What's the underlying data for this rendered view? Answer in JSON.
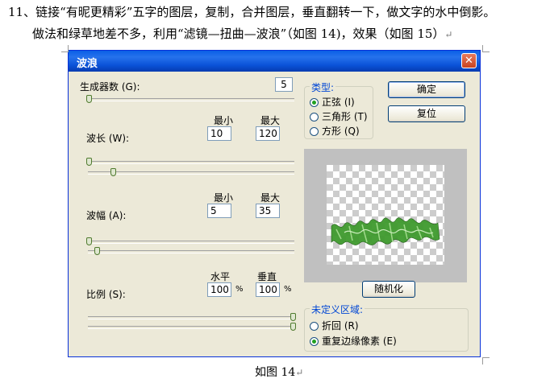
{
  "document": {
    "line1": "11、链接“有昵更精彩”五字的图层，复制，合并图层，垂直翻转一下，做文字的水中倒影。",
    "line2": "做法和绿草地差不多，利用“滤镜—扭曲—波浪”（如图 14)，效果（如图 15）",
    "caption": "如图 14",
    "para_mark": "↵"
  },
  "dialog": {
    "title": "波浪",
    "generators_label": "生成器数 (G):",
    "generators_value": "5",
    "wavelength": {
      "label": "波长 (W):",
      "min_header": "最小",
      "max_header": "最大",
      "min_value": "10",
      "max_value": "120"
    },
    "amplitude": {
      "label": "波幅 (A):",
      "min_header": "最小",
      "max_header": "最大",
      "min_value": "5",
      "max_value": "35"
    },
    "scale": {
      "label": "比例 (S):",
      "horizontal_header": "水平",
      "vertical_header": "垂直",
      "horizontal_value": "100",
      "vertical_value": "100",
      "unit": "%"
    },
    "type_group": {
      "title": "类型:",
      "options": [
        "正弦 (I)",
        "三角形 (T)",
        "方形 (Q)"
      ],
      "selected": 0
    },
    "undefined_group": {
      "title": "未定义区域:",
      "options": [
        "折回 (R)",
        "重复边缘像素 (E)"
      ],
      "selected": 1
    },
    "ok_label": "确定",
    "reset_label": "复位",
    "randomize_label": "随机化",
    "close_glyph": "✕",
    "slider_levels": {
      "generators": 0.0,
      "wavelength_min": 0.0,
      "wavelength_max": 0.12,
      "amplitude_min": 0.0,
      "amplitude_max": 0.04,
      "scale_horizontal": 1.0,
      "scale_vertical": 1.0
    }
  },
  "colors": {
    "titlebar": "#0a52d8",
    "dialog_bg": "#ece9d8",
    "preview_bg": "#c0c0c0",
    "grass": "#3f9a2e"
  }
}
